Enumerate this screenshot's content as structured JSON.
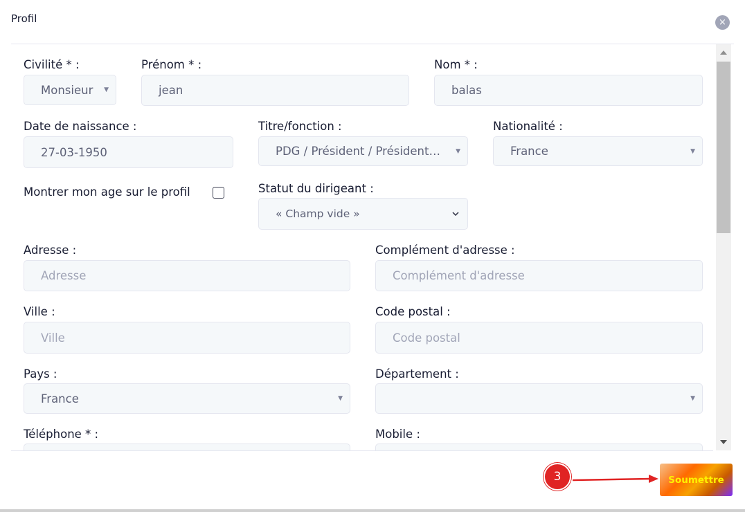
{
  "modal": {
    "title": "Profil",
    "close_icon": "×"
  },
  "form": {
    "civilite": {
      "label": "Civilité * :",
      "value": "Monsieur"
    },
    "prenom": {
      "label": "Prénom * :",
      "value": "jean"
    },
    "nom": {
      "label": "Nom * :",
      "value": "balas"
    },
    "date_naissance": {
      "label": "Date de naissance :",
      "value": "27-03-1950"
    },
    "titre": {
      "label": "Titre/fonction :",
      "value": "PDG / Président / Président…"
    },
    "nationalite": {
      "label": "Nationalité :",
      "value": "France"
    },
    "montrer_age": {
      "label": "Montrer mon age sur le profil",
      "checked": false
    },
    "statut": {
      "label": "Statut du dirigeant :",
      "value": "« Champ vide »"
    },
    "adresse": {
      "label": "Adresse :",
      "placeholder": "Adresse"
    },
    "complement": {
      "label": "Complément d'adresse :",
      "placeholder": "Complément d'adresse"
    },
    "ville": {
      "label": "Ville :",
      "placeholder": "Ville"
    },
    "code_postal": {
      "label": "Code postal :",
      "placeholder": "Code postal"
    },
    "pays": {
      "label": "Pays :",
      "value": "France"
    },
    "departement": {
      "label": "Département :",
      "value": ""
    },
    "telephone": {
      "label": "Téléphone * :"
    },
    "mobile": {
      "label": "Mobile :"
    }
  },
  "footer": {
    "submit_label": "Soumettre",
    "step_number": "3"
  },
  "colors": {
    "badge": "#e02424",
    "arrow": "#e02424",
    "submit_text": "#fff200"
  }
}
